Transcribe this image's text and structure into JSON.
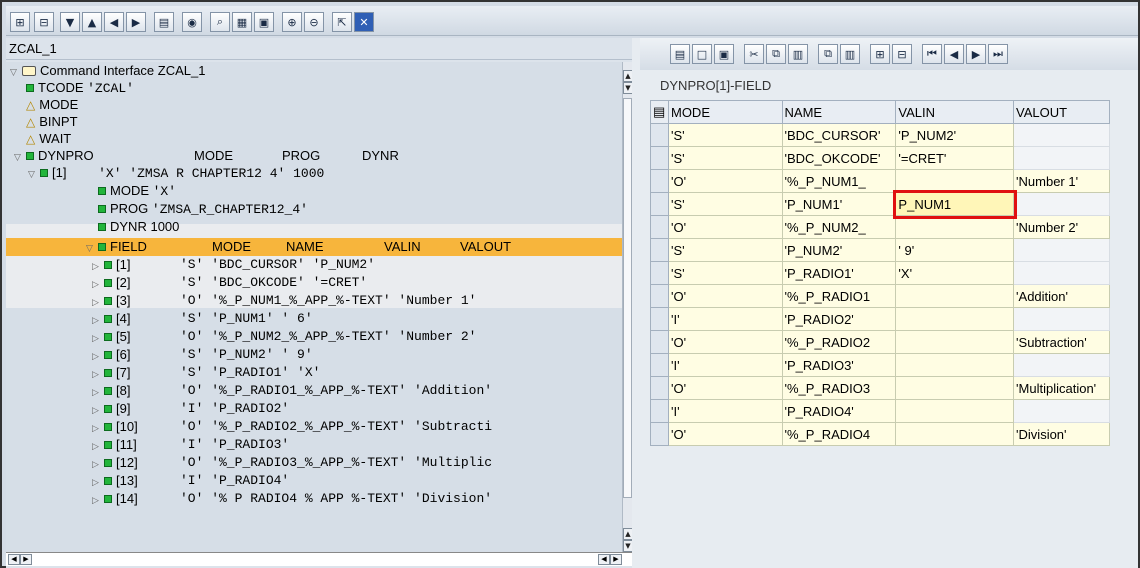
{
  "left": {
    "title": "ZCAL_1",
    "root": "Command Interface ZCAL_1",
    "tcode_label": "TCODE",
    "tcode_value": "'ZCAL'",
    "mode": "MODE",
    "binpt": "BINPT",
    "wait": "WAIT",
    "dynpro_header": [
      "DYNPRO",
      "MODE",
      "PROG",
      "DYNR"
    ],
    "dynpro1_label": "[1]",
    "dynpro1_values": "'X' 'ZMSA R CHAPTER12 4' 1000",
    "sub": [
      {
        "label": "MODE",
        "value": "'X'"
      },
      {
        "label": "PROG",
        "value": "'ZMSA_R_CHAPTER12_4'"
      },
      {
        "label": "DYNR",
        "value": "1000"
      }
    ],
    "field_header": [
      "FIELD",
      "MODE",
      "NAME",
      "VALIN",
      "VALOUT"
    ],
    "fields": [
      {
        "idx": "[1]",
        "text": "'S' 'BDC_CURSOR' 'P_NUM2'"
      },
      {
        "idx": "[2]",
        "text": "'S' 'BDC_OKCODE' '=CRET'"
      },
      {
        "idx": "[3]",
        "text": "'O' '%_P_NUM1_%_APP_%-TEXT' 'Number 1'"
      },
      {
        "idx": "[4]",
        "text": "'S' 'P_NUM1' '           6'"
      },
      {
        "idx": "[5]",
        "text": "'O' '%_P_NUM2_%_APP_%-TEXT' 'Number 2'"
      },
      {
        "idx": "[6]",
        "text": "'S' 'P_NUM2' '           9'"
      },
      {
        "idx": "[7]",
        "text": "'S' 'P_RADIO1' 'X'"
      },
      {
        "idx": "[8]",
        "text": "'O' '%_P_RADIO1_%_APP_%-TEXT' 'Addition'"
      },
      {
        "idx": "[9]",
        "text": "'I' 'P_RADIO2'"
      },
      {
        "idx": "[10]",
        "text": "'O' '%_P_RADIO2_%_APP_%-TEXT' 'Subtracti"
      },
      {
        "idx": "[11]",
        "text": "'I' 'P_RADIO3'"
      },
      {
        "idx": "[12]",
        "text": "'O' '%_P_RADIO3_%_APP_%-TEXT' 'Multiplic"
      },
      {
        "idx": "[13]",
        "text": "'I' 'P_RADIO4'"
      },
      {
        "idx": "[14]",
        "text": "'O' '% P RADIO4 % APP %-TEXT' 'Division'"
      }
    ]
  },
  "right": {
    "title": "DYNPRO[1]-FIELD",
    "columns": [
      "MODE",
      "NAME",
      "VALIN",
      "VALOUT"
    ],
    "rows": [
      [
        "'S'",
        "'BDC_CURSOR'",
        "'P_NUM2'",
        ""
      ],
      [
        "'S'",
        "'BDC_OKCODE'",
        "'=CRET'",
        ""
      ],
      [
        "'O'",
        "'%_P_NUM1_",
        "",
        "'Number 1'"
      ],
      [
        "'S'",
        "'P_NUM1'",
        "P_NUM1",
        ""
      ],
      [
        "'O'",
        "'%_P_NUM2_",
        "",
        "'Number 2'"
      ],
      [
        "'S'",
        "'P_NUM2'",
        "'           9'",
        ""
      ],
      [
        "'S'",
        "'P_RADIO1'",
        "'X'",
        ""
      ],
      [
        "'O'",
        "'%_P_RADIO1",
        "",
        "'Addition'"
      ],
      [
        "'I'",
        "'P_RADIO2'",
        "",
        ""
      ],
      [
        "'O'",
        "'%_P_RADIO2",
        "",
        "'Subtraction'"
      ],
      [
        "'I'",
        "'P_RADIO3'",
        "",
        ""
      ],
      [
        "'O'",
        "'%_P_RADIO3",
        "",
        "'Multiplication'"
      ],
      [
        "'I'",
        "'P_RADIO4'",
        "",
        ""
      ],
      [
        "'O'",
        "'%_P_RADIO4",
        "",
        "'Division'"
      ]
    ]
  },
  "icons": {
    "top": [
      "expand-all-icon",
      "collapse-all-icon",
      "triangle-down-icon",
      "triangle-up-icon",
      "triangle-left-icon",
      "triangle-right-icon",
      "layout-icon",
      "find-icon",
      "search-icon",
      "load-icon",
      "save-icon",
      "insert-icon",
      "delete-icon",
      "expand-icon",
      "close-icon"
    ],
    "right": [
      "details-icon",
      "new-icon",
      "save-icon",
      "cut-icon",
      "copy-icon",
      "paste-icon",
      "copy-row-icon",
      "paste-row-icon",
      "insert-row-icon",
      "delete-row-icon",
      "first-icon",
      "prev-icon",
      "next-icon",
      "last-icon"
    ]
  }
}
